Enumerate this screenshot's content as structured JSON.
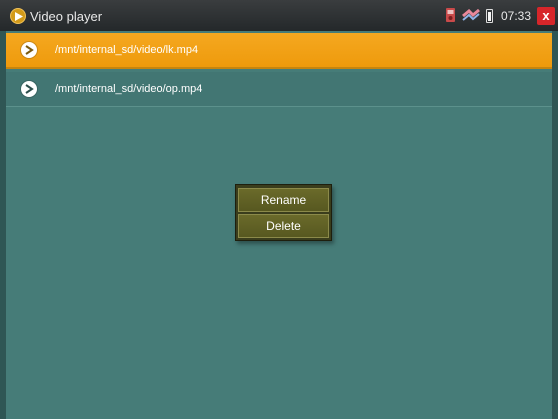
{
  "titlebar": {
    "title": "Video player",
    "time": "07:33",
    "close_label": "x"
  },
  "files": [
    {
      "path": "/mnt/internal_sd/video/lk.mp4",
      "selected": true
    },
    {
      "path": "/mnt/internal_sd/video/op.mp4",
      "selected": false
    }
  ],
  "context_menu": {
    "items": [
      {
        "label": "Rename"
      },
      {
        "label": "Delete"
      }
    ]
  },
  "colors": {
    "background": "#467c78",
    "selection": "#f5a820",
    "menu_item": "#6a6a2a",
    "close": "#d7262a"
  },
  "icons": [
    "app-logo-icon",
    "camera-icon",
    "network-icon",
    "battery-icon",
    "close-icon",
    "play-icon"
  ]
}
